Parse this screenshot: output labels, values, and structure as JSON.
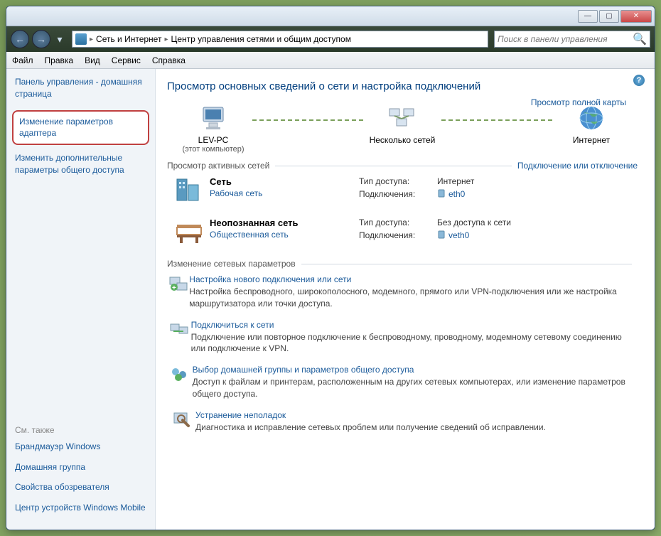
{
  "titlebar": {
    "minimize": "—",
    "maximize": "▢",
    "close": "✕"
  },
  "nav": {
    "back": "←",
    "forward": "→",
    "dropdown": "▾"
  },
  "breadcrumb": {
    "part1": "Сеть и Интернет",
    "part2": "Центр управления сетями и общим доступом",
    "sep": "▸"
  },
  "search": {
    "placeholder": "Поиск в панели управления"
  },
  "menu": {
    "file": "Файл",
    "edit": "Правка",
    "view": "Вид",
    "tools": "Сервис",
    "help": "Справка"
  },
  "sidebar": {
    "home": "Панель управления - домашняя страница",
    "adapter": "Изменение параметров адаптера",
    "sharing": "Изменить дополнительные параметры общего доступа",
    "seealso_title": "См. также",
    "seealso": {
      "firewall": "Брандмауэр Windows",
      "homegroup": "Домашняя группа",
      "browser": "Свойства обозревателя",
      "mobile": "Центр устройств Windows Mobile"
    }
  },
  "main": {
    "heading": "Просмотр основных сведений о сети и настройка подключений",
    "fullmap": "Просмотр полной карты",
    "nodes": {
      "pc": "LEV-PC",
      "pc_sub": "(этот компьютер)",
      "multi": "Несколько сетей",
      "internet": "Интернет"
    },
    "active_networks": "Просмотр активных сетей",
    "connect_disconnect": "Подключение или отключение",
    "net1": {
      "title": "Сеть",
      "type": "Рабочая сеть",
      "access_k": "Тип доступа:",
      "access_v": "Интернет",
      "conn_k": "Подключения:",
      "conn_v": "eth0"
    },
    "net2": {
      "title": "Неопознанная сеть",
      "type": "Общественная сеть",
      "access_k": "Тип доступа:",
      "access_v": "Без доступа к сети",
      "conn_k": "Подключения:",
      "conn_v": "veth0"
    },
    "change_settings": "Изменение сетевых параметров",
    "tasks": {
      "t1": {
        "title": "Настройка нового подключения или сети",
        "desc": "Настройка беспроводного, широкополосного, модемного, прямого или VPN-подключения или же настройка маршрутизатора или точки доступа."
      },
      "t2": {
        "title": "Подключиться к сети",
        "desc": "Подключение или повторное подключение к беспроводному, проводному, модемному сетевому соединению или подключение к VPN."
      },
      "t3": {
        "title": "Выбор домашней группы и параметров общего доступа",
        "desc": "Доступ к файлам и принтерам, расположенным на других сетевых компьютерах, или изменение параметров общего доступа."
      },
      "t4": {
        "title": "Устранение неполадок",
        "desc": "Диагностика и исправление сетевых проблем или получение сведений об исправлении."
      }
    }
  }
}
